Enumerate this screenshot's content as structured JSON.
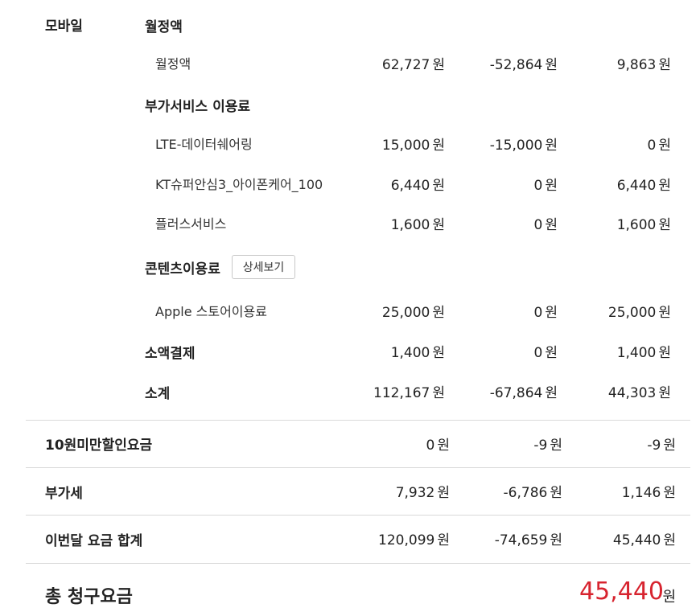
{
  "mobile": {
    "category": "모바일",
    "sections": {
      "monthly": {
        "title": "월정액",
        "items": [
          {
            "label": "월정액",
            "c1": "62,727",
            "c2": "-52,864",
            "c3": "9,863"
          }
        ]
      },
      "addon": {
        "title": "부가서비스 이용료",
        "items": [
          {
            "label": "LTE-데이터쉐어링",
            "c1": "15,000",
            "c2": "-15,000",
            "c3": "0"
          },
          {
            "label": "KT슈퍼안심3_아이폰케어_100",
            "c1": "6,440",
            "c2": "0",
            "c3": "6,440"
          },
          {
            "label": "플러스서비스",
            "c1": "1,600",
            "c2": "0",
            "c3": "1,600"
          }
        ]
      },
      "content": {
        "title": "콘텐츠이용료",
        "detail_button": "상세보기",
        "items": [
          {
            "label": "Apple 스토어이용료",
            "c1": "25,000",
            "c2": "0",
            "c3": "25,000"
          }
        ]
      },
      "micro": {
        "title": "소액결제",
        "c1": "1,400",
        "c2": "0",
        "c3": "1,400"
      },
      "subtotal": {
        "title": "소계",
        "c1": "112,167",
        "c2": "-67,864",
        "c3": "44,303"
      }
    }
  },
  "summary": [
    {
      "label": "10원미만할인요금",
      "c1": "0",
      "c2": "-9",
      "c3": "-9"
    },
    {
      "label": "부가세",
      "c1": "7,932",
      "c2": "-6,786",
      "c3": "1,146"
    },
    {
      "label": "이번달 요금 합계",
      "c1": "120,099",
      "c2": "-74,659",
      "c3": "45,440"
    }
  ],
  "total": {
    "label": "총 청구요금",
    "value": "45,440",
    "unit": "원"
  },
  "currency_unit": "원",
  "colors": {
    "accent": "#d7242f",
    "divider": "#d9d9d9"
  }
}
